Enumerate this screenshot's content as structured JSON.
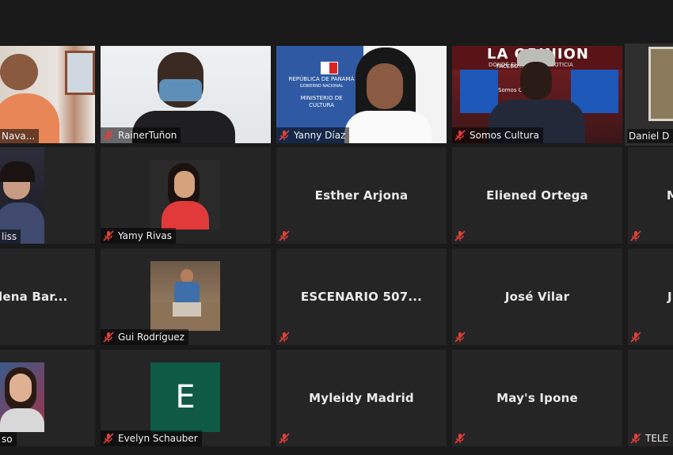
{
  "participants": {
    "row1": [
      {
        "name": "Nava..."
      },
      {
        "name": "RainerTuñon"
      },
      {
        "name": "Yanny Díaz",
        "backdrop_lines": [
          "REPÚBLICA DE PANAMÁ",
          "GOBIERNO NACIONAL",
          "MINISTERIO DE",
          "CULTURA"
        ]
      },
      {
        "name": "Somos Cultura",
        "backdrop_text": "LA OPINION",
        "backdrop_sub": "DONDE EL ...HACE LA NOTICIA",
        "screen_text": "FACEBO...",
        "screen_sub": "Somos C..."
      },
      {
        "name": "Daniel D"
      }
    ],
    "row2": [
      {
        "name": "liss"
      },
      {
        "name": "Yamy Rivas"
      },
      {
        "name": "Esther Arjona"
      },
      {
        "name": "Eliened Ortega"
      },
      {
        "name": "M"
      }
    ],
    "row3": [
      {
        "name": "lena Bar..."
      },
      {
        "name": "Gui Rodríguez"
      },
      {
        "name": "ESCENARIO 507..."
      },
      {
        "name": "José Vilar"
      },
      {
        "name": "J"
      }
    ],
    "row4": [
      {
        "name": "so"
      },
      {
        "name": "Evelyn Schauber",
        "avatar_letter": "E"
      },
      {
        "name": "Myleidy Madrid"
      },
      {
        "name": "May's Ipone"
      },
      {
        "name": "TELE"
      }
    ]
  },
  "colors": {
    "background": "#1a1a1a",
    "tile": "#252525",
    "active_speaker_border": "#c6d95a",
    "muted_icon": "#e0403a",
    "avatar_green": "#0f5a45"
  },
  "icons": {
    "muted": "microphone-muted-icon"
  }
}
